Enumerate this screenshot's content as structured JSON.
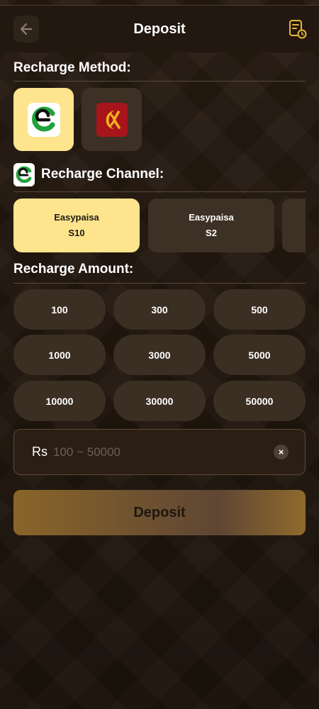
{
  "header": {
    "title": "Deposit",
    "back_icon": "arrow-left-icon",
    "record_icon": "deposit-history-icon"
  },
  "recharge_method": {
    "title": "Recharge Method:",
    "methods": [
      {
        "icon": "easypaisa-logo",
        "selected": true
      },
      {
        "icon": "jazzcash-logo",
        "selected": false
      }
    ]
  },
  "recharge_channel": {
    "title": "Recharge Channel:",
    "channels": [
      {
        "name": "Easypaisa",
        "code": "S10",
        "selected": true
      },
      {
        "name": "Easypaisa",
        "code": "S2",
        "selected": false
      }
    ]
  },
  "recharge_amount": {
    "title": "Recharge Amount:",
    "amounts": [
      "100",
      "300",
      "500",
      "1000",
      "3000",
      "5000",
      "10000",
      "30000",
      "50000"
    ]
  },
  "amount_input": {
    "currency": "Rs",
    "value": "",
    "placeholder": "100 ~ 50000",
    "clear_label": "×"
  },
  "deposit_button": {
    "label": "Deposit"
  },
  "colors": {
    "accent": "#fde48d",
    "background": "#2a1d12",
    "card": "#3d3025",
    "button_gold": "#8a6528"
  }
}
